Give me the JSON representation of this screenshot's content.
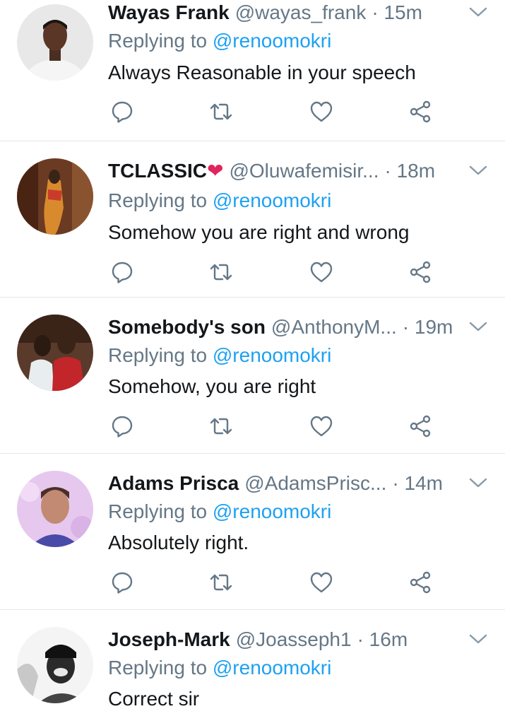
{
  "colors": {
    "text_primary": "#14171a",
    "text_secondary": "#657786",
    "link": "#1da1f2",
    "divider": "#e1e8ed",
    "heart": "#e0245e"
  },
  "replying_prefix": "Replying to",
  "tweets": [
    {
      "name": "Wayas Frank",
      "handle": "@wayas_frank",
      "time": "· 15m",
      "mention": "@renoomokri",
      "text": "Always Reasonable in your speech"
    },
    {
      "name": "TCLASSIC",
      "name_emoji": "❤",
      "handle": "@Oluwafemisir...",
      "time": "· 18m",
      "mention": "@renoomokri",
      "text": "Somehow you are right and wrong"
    },
    {
      "name": "Somebody's son",
      "handle": "@AnthonyM...",
      "time": "· 19m",
      "mention": "@renoomokri",
      "text": "Somehow, you are right"
    },
    {
      "name": "Adams Prisca",
      "handle": "@AdamsPrisc...",
      "time": "· 14m",
      "mention": "@renoomokri",
      "text": "Absolutely right."
    },
    {
      "name": "Joseph-Mark",
      "handle": "@Joasseph1",
      "time": "· 16m",
      "mention": "@renoomokri",
      "text": "Correct sir"
    }
  ],
  "icons": {
    "reply": "reply-icon",
    "retweet": "retweet-icon",
    "like": "like-icon",
    "share": "share-icon",
    "menu": "chevron-down-icon"
  }
}
